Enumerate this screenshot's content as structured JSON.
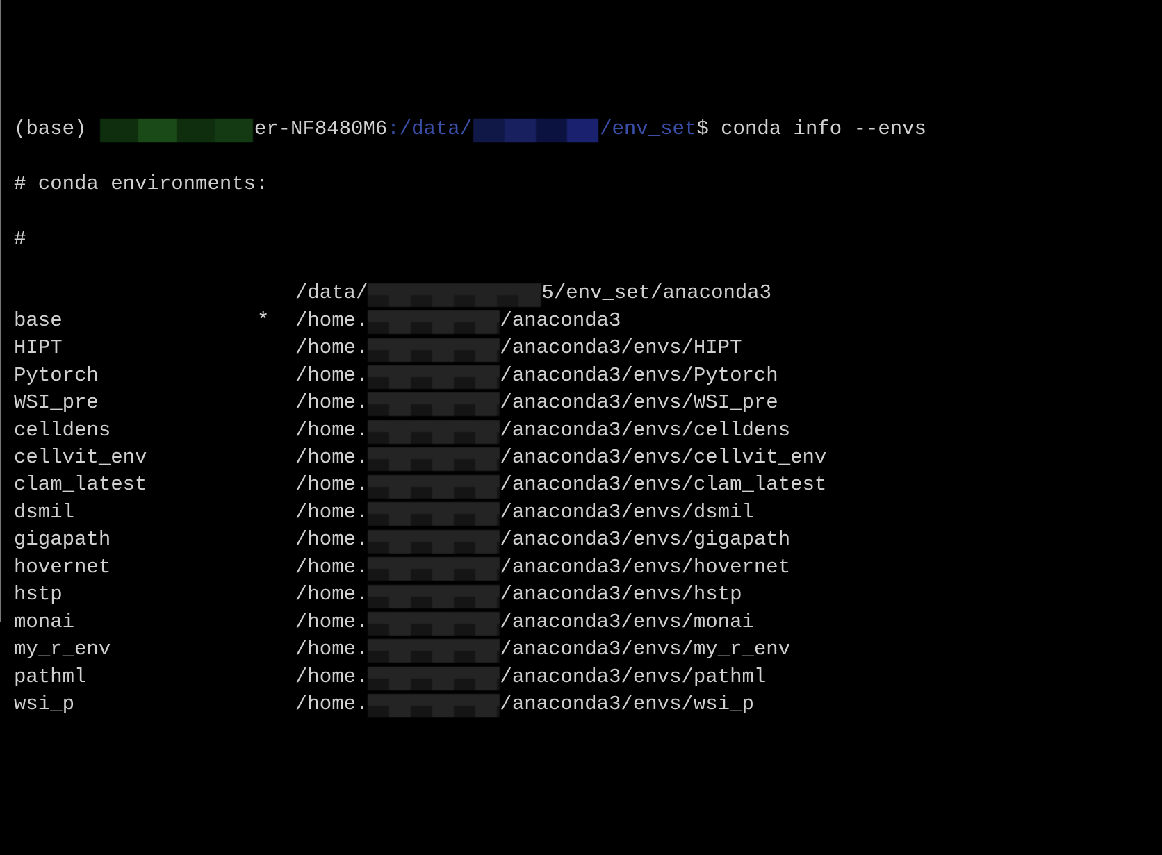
{
  "prompt": {
    "env": "(base) ",
    "host_suffix": "er-NF8480M6",
    "path_prefix": ":/data/",
    "path_suffix": "/env_set",
    "dollar": "$ ",
    "command": "conda info --envs"
  },
  "header": {
    "line1": "# conda environments:",
    "line2": "#"
  },
  "envs": [
    {
      "name": "",
      "active": " ",
      "path_prefix": "/data/",
      "path_redacted_wide": true,
      "path_suffix_pre": "5",
      "path_suffix": "/env_set/anaconda3"
    },
    {
      "name": "base",
      "active": "*",
      "path_prefix": "/home.",
      "path_redacted_wide": false,
      "path_suffix_pre": "/",
      "path_suffix": "anaconda3"
    },
    {
      "name": "HIPT",
      "active": " ",
      "path_prefix": "/home.",
      "path_redacted_wide": false,
      "path_suffix_pre": "/",
      "path_suffix": "anaconda3/envs/HIPT"
    },
    {
      "name": "Pytorch",
      "active": " ",
      "path_prefix": "/home.",
      "path_redacted_wide": false,
      "path_suffix_pre": "/",
      "path_suffix": "anaconda3/envs/Pytorch"
    },
    {
      "name": "WSI_pre",
      "active": " ",
      "path_prefix": "/home.",
      "path_redacted_wide": false,
      "path_suffix_pre": "/",
      "path_suffix": "anaconda3/envs/WSI_pre"
    },
    {
      "name": "celldens",
      "active": " ",
      "path_prefix": "/home.",
      "path_redacted_wide": false,
      "path_suffix_pre": "/",
      "path_suffix": "anaconda3/envs/celldens"
    },
    {
      "name": "cellvit_env",
      "active": " ",
      "path_prefix": "/home.",
      "path_redacted_wide": false,
      "path_suffix_pre": "/",
      "path_suffix": "anaconda3/envs/cellvit_env"
    },
    {
      "name": "clam_latest",
      "active": " ",
      "path_prefix": "/home.",
      "path_redacted_wide": false,
      "path_suffix_pre": "/",
      "path_suffix": "anaconda3/envs/clam_latest"
    },
    {
      "name": "dsmil",
      "active": " ",
      "path_prefix": "/home.",
      "path_redacted_wide": false,
      "path_suffix_pre": "/",
      "path_suffix": "anaconda3/envs/dsmil"
    },
    {
      "name": "gigapath",
      "active": " ",
      "path_prefix": "/home.",
      "path_redacted_wide": false,
      "path_suffix_pre": "/",
      "path_suffix": "anaconda3/envs/gigapath"
    },
    {
      "name": "hovernet",
      "active": " ",
      "path_prefix": "/home.",
      "path_redacted_wide": false,
      "path_suffix_pre": "/",
      "path_suffix": "anaconda3/envs/hovernet"
    },
    {
      "name": "hstp",
      "active": " ",
      "path_prefix": "/home.",
      "path_redacted_wide": false,
      "path_suffix_pre": "/",
      "path_suffix": "anaconda3/envs/hstp"
    },
    {
      "name": "monai",
      "active": " ",
      "path_prefix": "/home.",
      "path_redacted_wide": false,
      "path_suffix_pre": "/",
      "path_suffix": "anaconda3/envs/monai"
    },
    {
      "name": "my_r_env",
      "active": " ",
      "path_prefix": "/home.",
      "path_redacted_wide": false,
      "path_suffix_pre": "/",
      "path_suffix": "anaconda3/envs/my_r_env"
    },
    {
      "name": "pathml",
      "active": " ",
      "path_prefix": "/home.",
      "path_redacted_wide": false,
      "path_suffix_pre": "/",
      "path_suffix": "anaconda3/envs/pathml"
    },
    {
      "name": "wsi_p",
      "active": " ",
      "path_prefix": "/home.",
      "path_redacted_wide": false,
      "path_suffix_pre": "/",
      "path_suffix": "anaconda3/envs/wsi_p"
    }
  ]
}
